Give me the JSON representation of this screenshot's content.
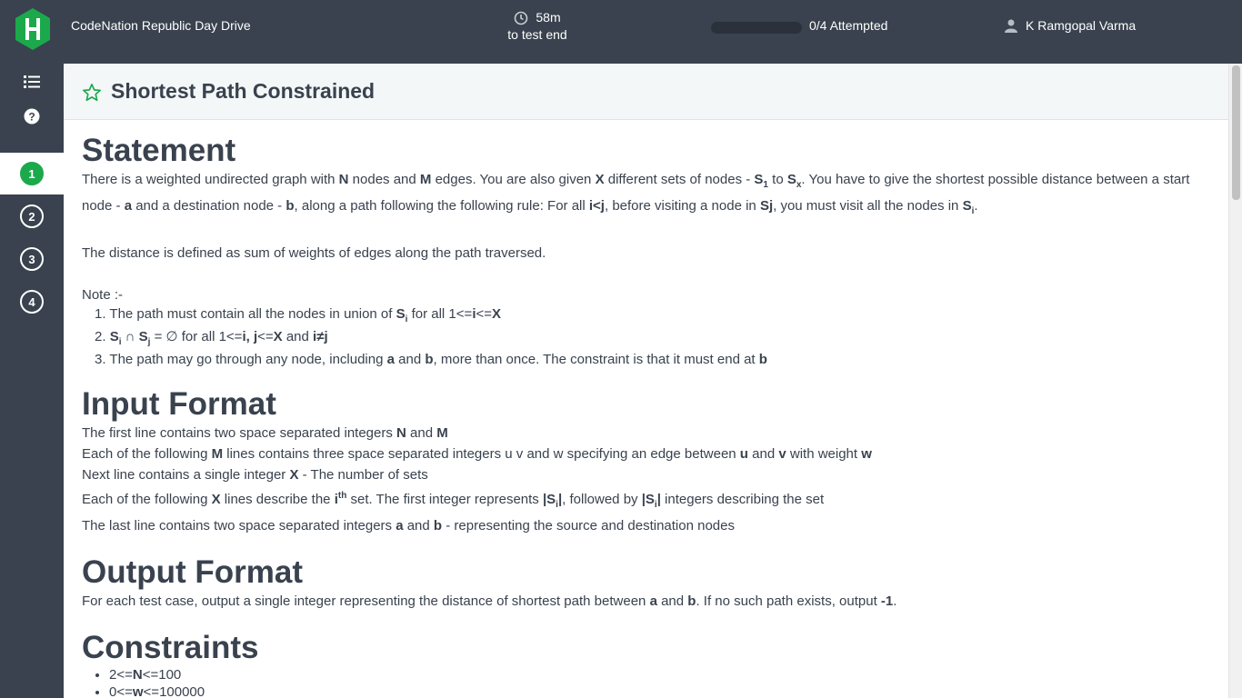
{
  "header": {
    "contest_title": "CodeNation Republic Day Drive",
    "timer_value": "58m",
    "timer_label": "to test end",
    "progress_fraction": 0,
    "attempted": "0/4 Attempted",
    "user_name": "K Ramgopal Varma"
  },
  "sidebar": {
    "questions": [
      "1",
      "2",
      "3",
      "4"
    ],
    "active_question": "1"
  },
  "question": {
    "title": "Shortest Path Constrained"
  },
  "content": {
    "statement_heading": "Statement",
    "statement": {
      "t1": "There is a weighted undirected graph with ",
      "N": "N",
      "t2": " nodes and ",
      "M": "M",
      "t3": " edges. You are also given ",
      "X": "X",
      "t4": " different sets of nodes - ",
      "S": "S",
      "sub1": "1",
      "t5": " to ",
      "subX": "x",
      "t6": ". You have to give the shortest possible distance between a start node - ",
      "a": "a",
      "t7": " and a destination node - ",
      "b": "b",
      "t8": ", along a path following the following rule: For all ",
      "ilj": "i<j",
      "t9": ", before visiting a node in ",
      "Sj": "Sj",
      "t10": ", you must visit all the nodes in ",
      "subi": "i",
      "t11": "."
    },
    "distance_text": "The distance is defined as sum of weights of edges along the path traversed.",
    "note_label": "Note :-",
    "notes": {
      "n1_a": "1. The path must contain all the nodes in union of ",
      "n1_S": "S",
      "n1_sub": "i",
      "n1_b": " for all 1<=",
      "n1_i": "i",
      "n1_c": "<=",
      "n1_X": "X",
      "n2_a": "2. ",
      "n2_S1": "S",
      "n2_sub1": "i",
      "n2_cap": " ∩ ",
      "n2_S2": "S",
      "n2_sub2": "j",
      "n2_b": " = ∅ for all 1<=",
      "n2_ij": "i, j",
      "n2_c": "<=",
      "n2_X": "X",
      "n2_d": " and ",
      "n2_neq": "i≠j",
      "n3_a": "3. The path may go through any node, including ",
      "n3_a2": "a",
      "n3_b": " and ",
      "n3_b2": "b",
      "n3_c": ", more than once. The constraint is that it must end at ",
      "n3_b3": "b"
    },
    "input_heading": "Input Format",
    "input": {
      "l1_a": "The first line contains two space separated integers ",
      "l1_N": "N",
      "l1_b": " and ",
      "l1_M": "M",
      "l2_a": "Each of the following ",
      "l2_M": "M",
      "l2_b": " lines contains three space separated integers u v and w specifying an edge between ",
      "l2_u": "u",
      "l2_c": " and ",
      "l2_v": "v",
      "l2_d": " with weight ",
      "l2_w": "w",
      "l3_a": "Next line contains a single integer ",
      "l3_X": "X",
      "l3_b": " - The number of sets",
      "l4_a": "Each of the following ",
      "l4_X": "X",
      "l4_b": " lines describe the ",
      "l4_i": "i",
      "l4_th": "th",
      "l4_c": " set. The first integer represents ",
      "l4_s1": "|S",
      "l4_sub1": "i",
      "l4_s1e": "|",
      "l4_d": ", followed by ",
      "l4_s2": "|S",
      "l4_sub2": "i",
      "l4_s2e": "|",
      "l4_e": " integers describing the set",
      "l5_a": "The last line contains two space separated integers ",
      "l5_a2": "a",
      "l5_b": " and ",
      "l5_b2": "b",
      "l5_c": " - representing the source and destination nodes"
    },
    "output_heading": "Output Format",
    "output": {
      "o_a": "For each test case, output a single integer representing the distance of shortest path between ",
      "o_a2": "a",
      "o_b": " and ",
      "o_b2": "b",
      "o_c": ". If no such path exists, output ",
      "o_neg": "-1",
      "o_d": "."
    },
    "constraints_heading": "Constraints",
    "constraints": {
      "c1_a": "2<=",
      "c1_N": "N",
      "c1_b": "<=100",
      "c2_a": "0<=",
      "c2_w": "w",
      "c2_b": "<=100000"
    }
  },
  "colors": {
    "header_bg": "#39424e",
    "accent_green": "#1ba94c",
    "title_bar_bg": "#f3f7f7",
    "text": "#39424e"
  },
  "icons": {
    "logo": "hackerrank-hexagon-logo",
    "timer": "clock-icon",
    "user": "user-icon",
    "list": "list-icon",
    "help": "help-icon",
    "star": "star-outline-icon"
  }
}
